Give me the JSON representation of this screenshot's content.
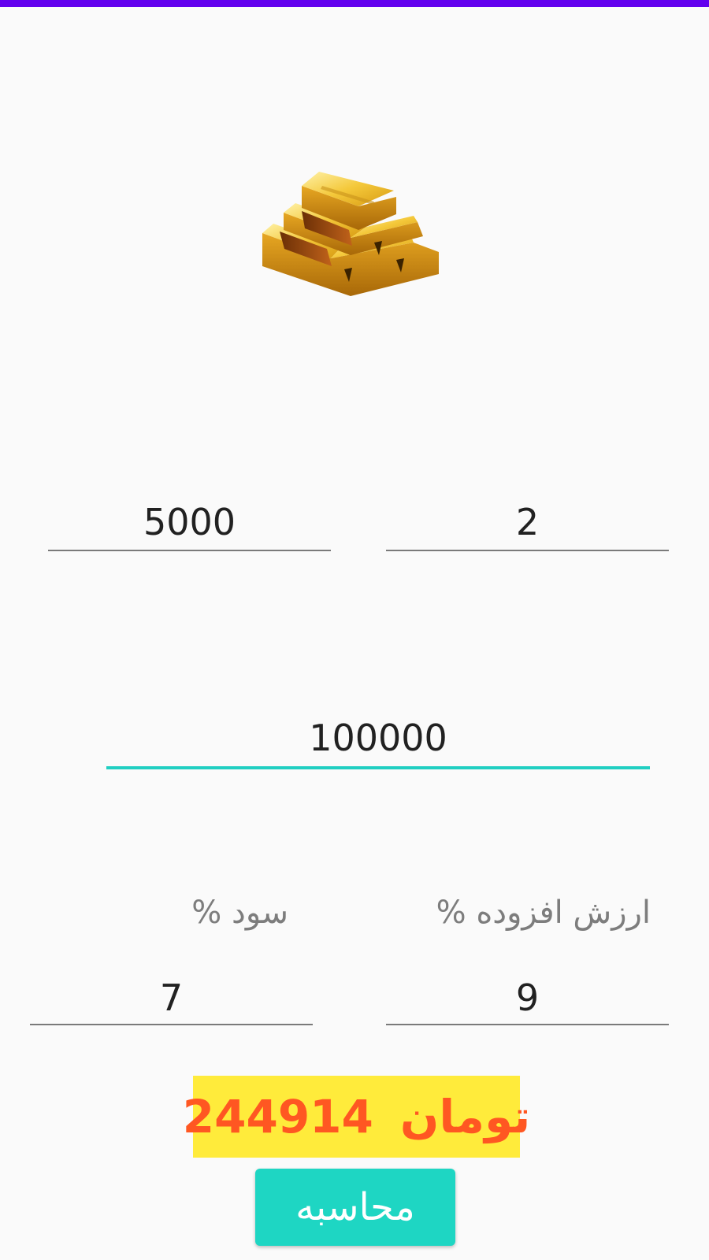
{
  "status_bar": {
    "color": "#6200ee"
  },
  "image": {
    "icon": "gold-bars-image"
  },
  "fields": {
    "top_left_value": "5000",
    "top_right_value": "2",
    "main_value": "100000",
    "profit_label": "سود %",
    "vat_label": "ارزش افزوده %",
    "profit_value": "7",
    "vat_value": "9"
  },
  "result": {
    "currency": "تومان",
    "amount": "244914",
    "bg_color": "#ffeb3b",
    "text_color": "#ff5722"
  },
  "button": {
    "label": "محاسبه",
    "color": "#1ed6c3"
  }
}
